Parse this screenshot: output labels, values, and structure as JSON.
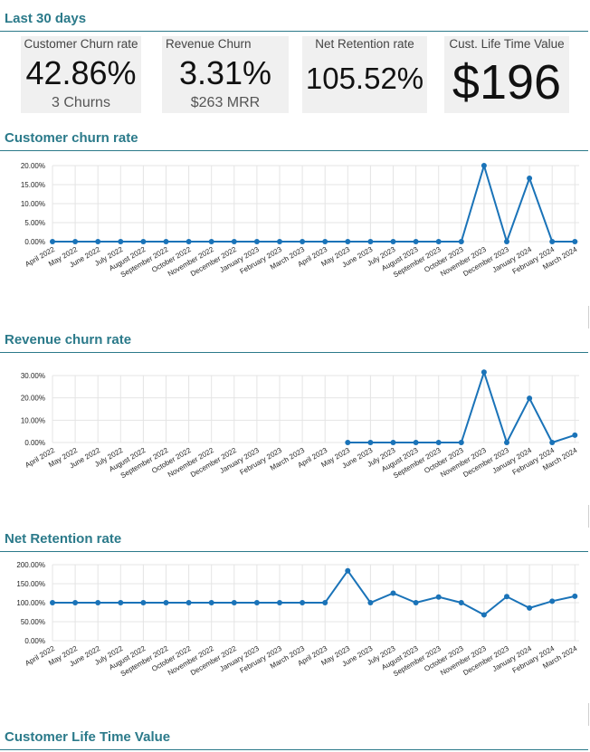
{
  "sections": {
    "last30": "Last 30 days",
    "customer_churn": "Customer churn rate",
    "revenue_churn": "Revenue churn rate",
    "net_retention": "Net Retention rate",
    "ltv": "Customer Life Time Value"
  },
  "kpis": [
    {
      "label": "Customer Churn rate",
      "value": "42.86%",
      "sub": "3 Churns"
    },
    {
      "label": "Revenue Churn",
      "value": "3.31%",
      "sub": "$263 MRR"
    },
    {
      "label": "Net Retention rate",
      "value": "105.52%",
      "sub": ""
    },
    {
      "label": "Cust. Life Time Value",
      "value": "$196",
      "sub": ""
    }
  ],
  "colors": {
    "accent": "#2b7a8a",
    "series": "#1a73b8",
    "kpi_bg": "#f0f0f0"
  },
  "chart_data": [
    {
      "type": "line",
      "categories": [
        "April 2022",
        "May 2022",
        "June 2022",
        "July 2022",
        "August 2022",
        "September 2022",
        "October 2022",
        "November 2022",
        "December 2022",
        "January 2023",
        "February 2023",
        "March 2023",
        "April 2023",
        "May 2023",
        "June 2023",
        "July 2023",
        "August 2023",
        "September 2023",
        "October 2023",
        "November 2023",
        "December 2023",
        "January 2024",
        "February 2024",
        "March 2024"
      ],
      "series": [
        {
          "values": [
            0,
            0,
            0,
            0,
            0,
            0,
            0,
            0,
            0,
            0,
            0,
            0,
            0,
            0,
            0,
            0,
            0,
            0,
            0,
            20,
            0,
            16.67,
            0,
            0
          ]
        }
      ],
      "yticks": [
        "0.00%",
        "5.00%",
        "10.00%",
        "15.00%",
        "20.00%"
      ],
      "ylim": [
        0,
        20
      ],
      "grid": true
    },
    {
      "type": "line",
      "categories": [
        "April 2022",
        "May 2022",
        "June 2022",
        "July 2022",
        "August 2022",
        "September 2022",
        "October 2022",
        "November 2022",
        "December 2022",
        "January 2023",
        "February 2023",
        "March 2023",
        "April 2023",
        "May 2023",
        "June 2023",
        "July 2023",
        "August 2023",
        "September 2023",
        "October 2023",
        "November 2023",
        "December 2023",
        "January 2024",
        "February 2024",
        "March 2024"
      ],
      "series": [
        {
          "values": [
            null,
            null,
            null,
            null,
            null,
            null,
            null,
            null,
            null,
            null,
            null,
            null,
            null,
            0,
            0,
            0,
            0,
            0,
            0,
            31.5,
            0,
            19.8,
            0,
            3.31
          ]
        }
      ],
      "yticks": [
        "0.00%",
        "10.00%",
        "20.00%",
        "30.00%"
      ],
      "ylim": [
        0,
        30
      ],
      "grid": true
    },
    {
      "type": "line",
      "categories": [
        "April 2022",
        "May 2022",
        "June 2022",
        "July 2022",
        "August 2022",
        "September 2022",
        "October 2022",
        "November 2022",
        "December 2022",
        "January 2023",
        "February 2023",
        "March 2023",
        "April 2023",
        "May 2023",
        "June 2023",
        "July 2023",
        "August 2023",
        "September 2023",
        "October 2023",
        "November 2023",
        "December 2023",
        "January 2024",
        "February 2024",
        "March 2024"
      ],
      "series": [
        {
          "values": [
            100,
            100,
            100,
            100,
            100,
            100,
            100,
            100,
            100,
            100,
            100,
            100,
            100,
            184,
            100,
            125,
            100,
            115,
            100,
            68,
            116,
            86,
            104,
            117
          ]
        }
      ],
      "yticks": [
        "0.00%",
        "50.00%",
        "100.00%",
        "150.00%",
        "200.00%"
      ],
      "ylim": [
        0,
        200
      ],
      "grid": true
    }
  ]
}
